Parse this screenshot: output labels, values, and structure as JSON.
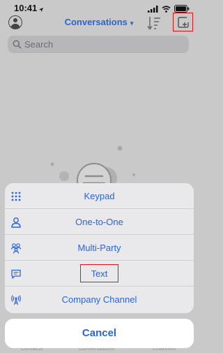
{
  "status_bar": {
    "time": "10:41",
    "location_icon": "location-arrow-icon"
  },
  "header": {
    "title": "Conversations",
    "title_caret": "▾"
  },
  "search": {
    "placeholder": "Search"
  },
  "tab_bar": {
    "items": [
      "Contacts",
      "Conversations",
      "Channels"
    ]
  },
  "action_sheet": {
    "items": [
      {
        "label": "Keypad",
        "icon": "keypad-icon"
      },
      {
        "label": "One-to-One",
        "icon": "person-icon"
      },
      {
        "label": "Multi-Party",
        "icon": "group-icon"
      },
      {
        "label": "Text",
        "icon": "message-icon"
      },
      {
        "label": "Company Channel",
        "icon": "broadcast-icon"
      }
    ],
    "cancel_label": "Cancel"
  },
  "colors": {
    "accent": "#2c63d6",
    "highlight_box": "#e0141b",
    "dim_background": "#c9c9c9",
    "sheet_background": "#e9e9eb"
  }
}
